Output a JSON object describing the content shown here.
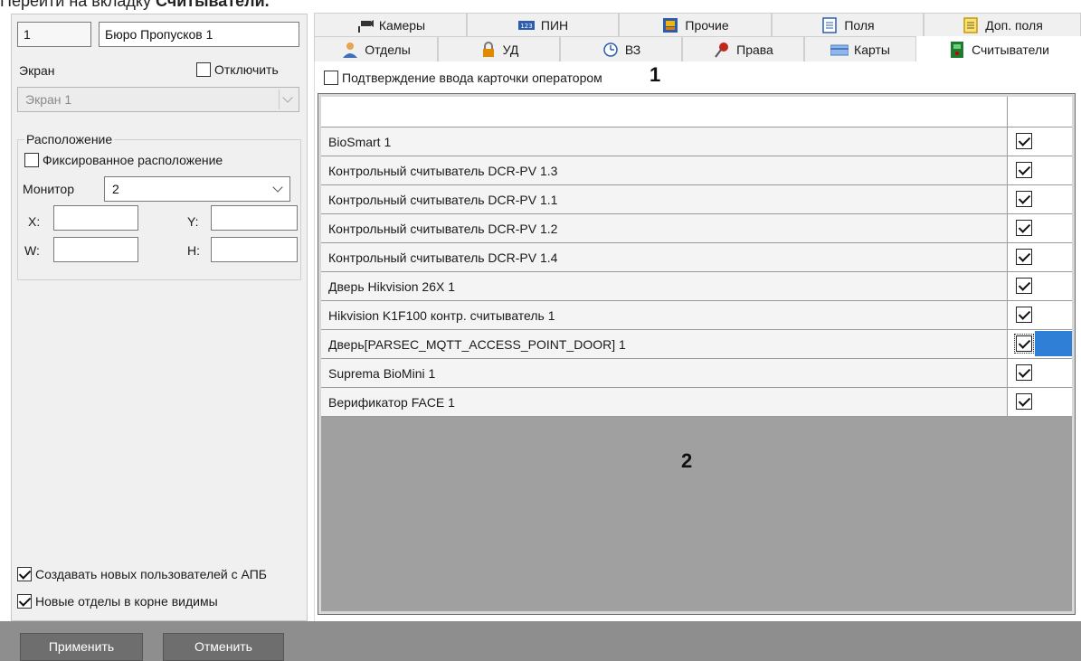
{
  "caption": {
    "prefix": "Перейти на вкладку ",
    "bold": "Считыватели."
  },
  "left": {
    "id_value": "1",
    "name_value": "Бюро Пропусков 1",
    "screen_label": "Экран",
    "disable_label": "Отключить",
    "disable_checked": false,
    "screen_select_value": "Экран 1",
    "location_group_label": "Расположение",
    "fixed_location_label": "Фиксированное расположение",
    "fixed_location_checked": false,
    "monitor_label": "Монитор",
    "monitor_value": "2",
    "x_label": "X:",
    "y_label": "Y:",
    "w_label": "W:",
    "h_label": "H:",
    "x_value": "",
    "y_value": "",
    "w_value": "",
    "h_value": "",
    "create_users_apb_label": "Создавать новых пользователей с АПБ",
    "create_users_apb_checked": true,
    "new_departments_root_label": "Новые отделы в корне видимы",
    "new_departments_root_checked": true
  },
  "tabs_row1": [
    {
      "label": "Камеры",
      "icon": "camera-icon"
    },
    {
      "label": "ПИН",
      "icon": "pin-keypad-icon"
    },
    {
      "label": "Прочие",
      "icon": "misc-icon"
    },
    {
      "label": "Поля",
      "icon": "fields-list-icon"
    },
    {
      "label": "Доп. поля",
      "icon": "extra-fields-icon"
    }
  ],
  "tabs_row2": [
    {
      "label": "Отделы",
      "icon": "department-person-icon"
    },
    {
      "label": "УД",
      "icon": "lock-icon"
    },
    {
      "label": "ВЗ",
      "icon": "clock-icon"
    },
    {
      "label": "Права",
      "icon": "pin-marker-icon"
    },
    {
      "label": "Карты",
      "icon": "card-icon"
    },
    {
      "label": "Считыватели",
      "icon": "reader-icon",
      "active": true
    }
  ],
  "operator_confirm_label": "Подтверждение ввода карточки оператором",
  "operator_confirm_checked": false,
  "marker_1": "1",
  "marker_2": "2",
  "readers": [
    {
      "name": "BioSmart 1",
      "checked": true
    },
    {
      "name": "Контрольный считыватель DCR-PV 1.3",
      "checked": true
    },
    {
      "name": "Контрольный считыватель DCR-PV 1.1",
      "checked": true
    },
    {
      "name": "Контрольный считыватель DCR-PV 1.2",
      "checked": true
    },
    {
      "name": "Контрольный считыватель DCR-PV 1.4",
      "checked": true
    },
    {
      "name": "Дверь Hikvision 26X 1",
      "checked": true
    },
    {
      "name": "Hikvision K1F100 контр. считыватель 1",
      "checked": true
    },
    {
      "name": "Дверь[PARSEC_MQTT_ACCESS_POINT_DOOR] 1",
      "checked": true,
      "selected": true
    },
    {
      "name": "Suprema BioMini 1",
      "checked": true
    },
    {
      "name": "Верификатор FACE 1",
      "checked": true
    }
  ],
  "buttons": {
    "apply": "Применить",
    "cancel": "Отменить"
  },
  "colors": {
    "selection": "#2f7fd6",
    "grid_background": "#a0a0a0",
    "bottom_bar": "#8e8e8e"
  }
}
